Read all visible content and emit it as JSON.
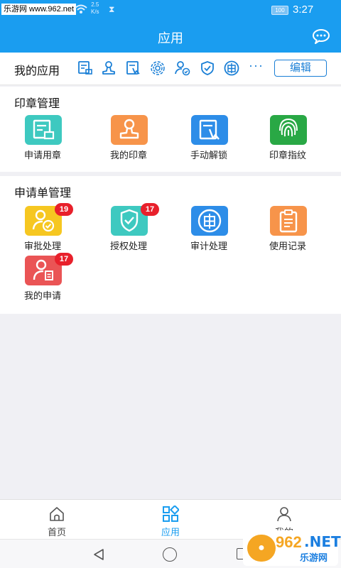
{
  "status_bar": {
    "watermark": "乐游网 www.962.net",
    "network_speed_value": "2.5",
    "network_speed_unit": "K/s",
    "battery": "100",
    "time": "3:27"
  },
  "header": {
    "title": "应用",
    "chat_icon": "chat-bubble-icon"
  },
  "my_apps": {
    "label": "我的应用",
    "icons": [
      "apply-seal-icon",
      "seal-icon",
      "unlock-icon",
      "fingerprint-icon",
      "approve-user-icon",
      "shield-check-icon",
      "audit-icon",
      "more-icon"
    ],
    "more": "···",
    "edit_label": "编辑"
  },
  "seal_section": {
    "title": "印章管理",
    "items": [
      {
        "label": "申请用章",
        "icon": "apply-seal-icon",
        "color": "#3ec9c0"
      },
      {
        "label": "我的印章",
        "icon": "seal-icon",
        "color": "#f7944a"
      },
      {
        "label": "手动解锁",
        "icon": "unlock-icon",
        "color": "#2d8de8"
      },
      {
        "label": "印章指纹",
        "icon": "fingerprint-icon",
        "color": "#29a845"
      }
    ]
  },
  "request_section": {
    "title": "申请单管理",
    "items": [
      {
        "label": "审批处理",
        "icon": "approve-user-icon",
        "color": "#f6c721",
        "badge": "19"
      },
      {
        "label": "授权处理",
        "icon": "shield-check-icon",
        "color": "#3ec9c0",
        "badge": "17"
      },
      {
        "label": "审计处理",
        "icon": "audit-icon",
        "color": "#2d8de8"
      },
      {
        "label": "使用记录",
        "icon": "clipboard-icon",
        "color": "#f7944a"
      },
      {
        "label": "我的申请",
        "icon": "my-request-icon",
        "color": "#ea5455",
        "badge": "17"
      }
    ]
  },
  "bottom_nav": {
    "items": [
      {
        "label": "首页",
        "icon": "home-icon",
        "active": false
      },
      {
        "label": "应用",
        "icon": "apps-grid-icon",
        "active": true
      },
      {
        "label": "我的",
        "icon": "user-icon",
        "active": false
      }
    ],
    "active_color": "#1a9df0"
  },
  "bottom_watermark": {
    "brand": "962",
    "net": ".NET",
    "site": "乐游网"
  }
}
